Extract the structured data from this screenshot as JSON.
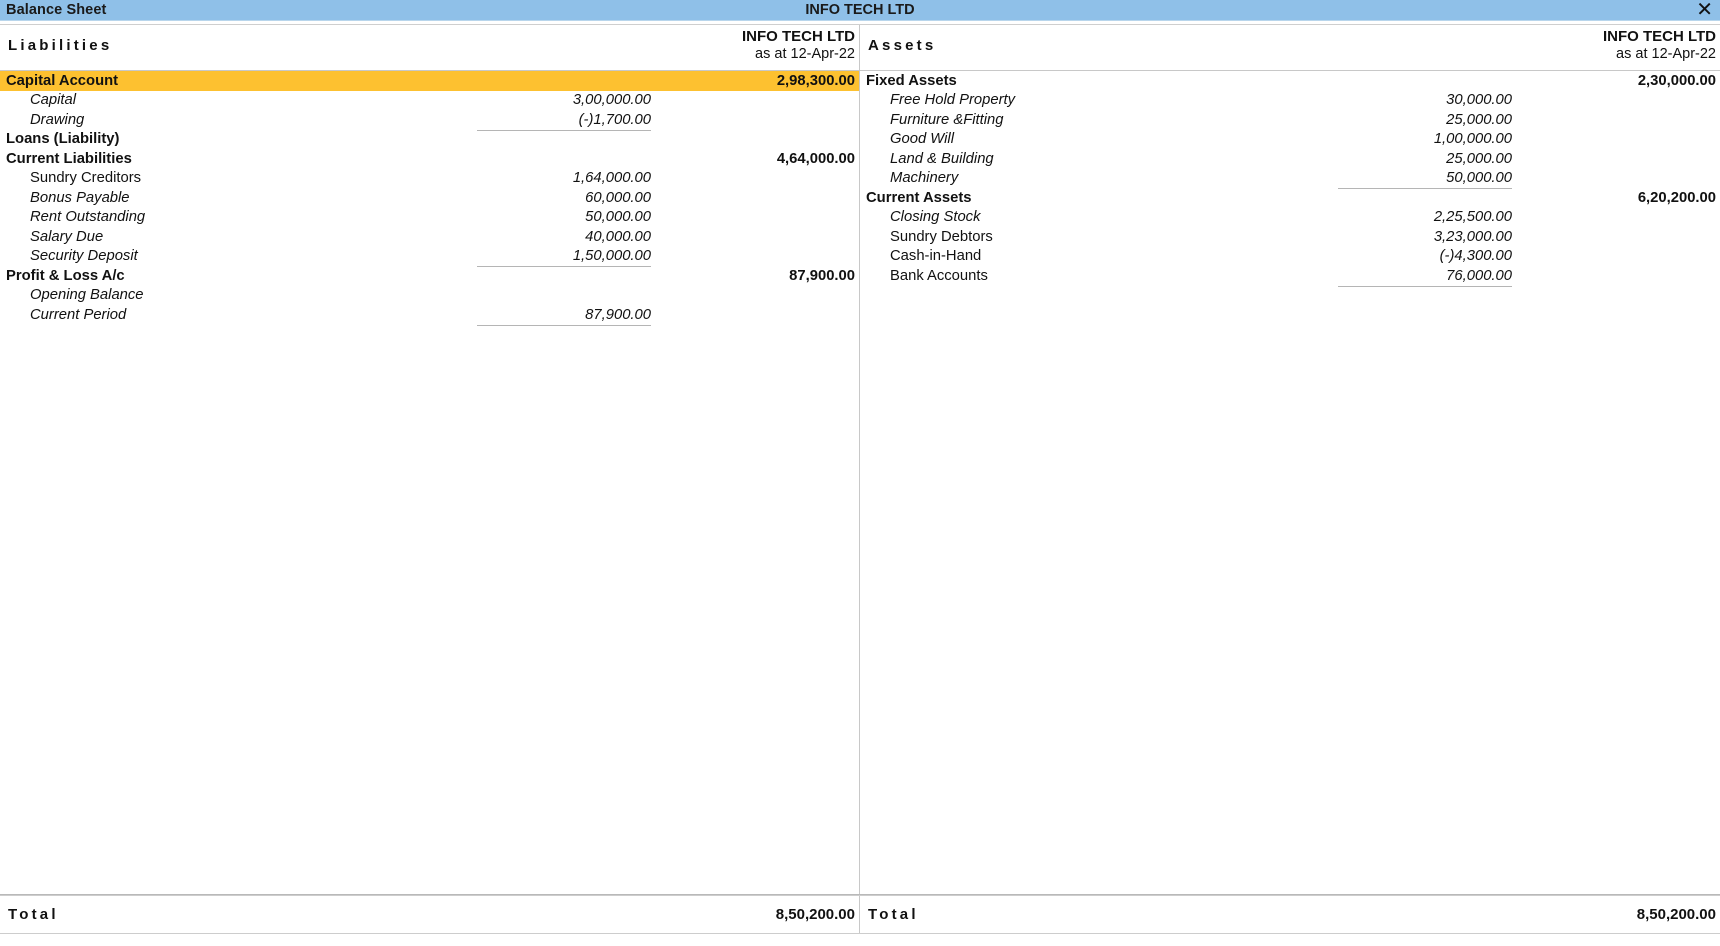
{
  "window": {
    "title": "Balance Sheet",
    "center_title": "INFO TECH LTD",
    "close_icon": "close-icon",
    "close_glyph": "✕"
  },
  "colors": {
    "titlebar": "#8fc0e8",
    "highlight": "#fdc130",
    "text": "#111111",
    "rule": "#b5b5b5"
  },
  "liabilities": {
    "side_label": "Liabilities",
    "company": "INFO TECH LTD",
    "as_at": "as at 12-Apr-22",
    "total_label": "Total",
    "total_amount": "8,50,200.00",
    "rows": [
      {
        "label": "Capital Account",
        "sub": "",
        "main": "2,98,300.00",
        "kind": "group",
        "highlight": true
      },
      {
        "label": "Capital",
        "sub": "3,00,000.00",
        "main": "",
        "kind": "item"
      },
      {
        "label": "Drawing",
        "sub": "(-)1,700.00",
        "main": "",
        "kind": "item",
        "ruled": true
      },
      {
        "label": "Loans (Liability)",
        "sub": "",
        "main": "",
        "kind": "group"
      },
      {
        "label": "Current Liabilities",
        "sub": "",
        "main": "4,64,000.00",
        "kind": "group"
      },
      {
        "label": "Sundry Creditors",
        "sub": "1,64,000.00",
        "main": "",
        "kind": "item",
        "upright": true
      },
      {
        "label": "Bonus Payable",
        "sub": "60,000.00",
        "main": "",
        "kind": "item"
      },
      {
        "label": "Rent Outstanding",
        "sub": "50,000.00",
        "main": "",
        "kind": "item"
      },
      {
        "label": "Salary Due",
        "sub": "40,000.00",
        "main": "",
        "kind": "item"
      },
      {
        "label": "Security Deposit",
        "sub": "1,50,000.00",
        "main": "",
        "kind": "item",
        "ruled": true
      },
      {
        "label": "Profit & Loss A/c",
        "sub": "",
        "main": "87,900.00",
        "kind": "group"
      },
      {
        "label": "Opening Balance",
        "sub": "",
        "main": "",
        "kind": "item"
      },
      {
        "label": "Current Period",
        "sub": "87,900.00",
        "main": "",
        "kind": "item",
        "ruled": true
      }
    ]
  },
  "assets": {
    "side_label": "Assets",
    "company": "INFO TECH LTD",
    "as_at": "as at 12-Apr-22",
    "total_label": "Total",
    "total_amount": "8,50,200.00",
    "rows": [
      {
        "label": "Fixed Assets",
        "sub": "",
        "main": "2,30,000.00",
        "kind": "group"
      },
      {
        "label": "Free Hold Property",
        "sub": "30,000.00",
        "main": "",
        "kind": "item"
      },
      {
        "label": "Furniture &Fitting",
        "sub": "25,000.00",
        "main": "",
        "kind": "item"
      },
      {
        "label": "Good Will",
        "sub": "1,00,000.00",
        "main": "",
        "kind": "item"
      },
      {
        "label": "Land & Building",
        "sub": "25,000.00",
        "main": "",
        "kind": "item"
      },
      {
        "label": "Machinery",
        "sub": "50,000.00",
        "main": "",
        "kind": "item",
        "ruled": true
      },
      {
        "label": "Current Assets",
        "sub": "",
        "main": "6,20,200.00",
        "kind": "group"
      },
      {
        "label": "Closing Stock",
        "sub": "2,25,500.00",
        "main": "",
        "kind": "item"
      },
      {
        "label": "Sundry Debtors",
        "sub": "3,23,000.00",
        "main": "",
        "kind": "item",
        "upright": true
      },
      {
        "label": "Cash-in-Hand",
        "sub": "(-)4,300.00",
        "main": "",
        "kind": "item",
        "upright": true
      },
      {
        "label": "Bank Accounts",
        "sub": "76,000.00",
        "main": "",
        "kind": "item",
        "upright": true,
        "ruled": true
      }
    ]
  }
}
